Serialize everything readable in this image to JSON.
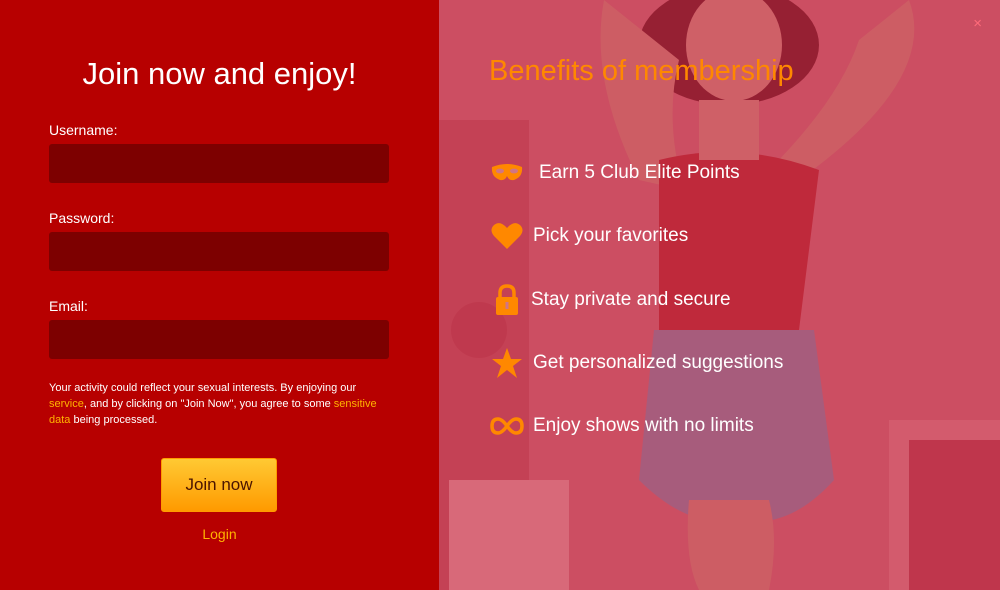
{
  "signup": {
    "title": "Join now and enjoy!",
    "username_label": "Username:",
    "password_label": "Password:",
    "email_label": "Email:",
    "username_value": "",
    "password_value": "",
    "email_value": "",
    "legal": {
      "part1": "Your activity could reflect your sexual interests. By enjoying our ",
      "link1": "service",
      "part2": ", and by clicking on \"Join Now\", you agree to some ",
      "link2": "sensitive data",
      "part3": " being processed."
    },
    "join_button": "Join now",
    "login_link": "Login"
  },
  "benefits": {
    "title": "Benefits of membership",
    "close_glyph": "×",
    "items": [
      {
        "icon": "mask-icon",
        "label": "Earn 5 Club Elite Points"
      },
      {
        "icon": "heart-icon",
        "label": "Pick your favorites"
      },
      {
        "icon": "lock-icon",
        "label": "Stay private and secure"
      },
      {
        "icon": "star-icon",
        "label": "Get personalized suggestions"
      },
      {
        "icon": "infinity-icon",
        "label": "Enjoy shows with no limits"
      }
    ]
  },
  "colors": {
    "left_panel": "#b70000",
    "input_bg": "#7d0000",
    "accent_orange": "#ff8800",
    "link_yellow": "#ffb300"
  }
}
